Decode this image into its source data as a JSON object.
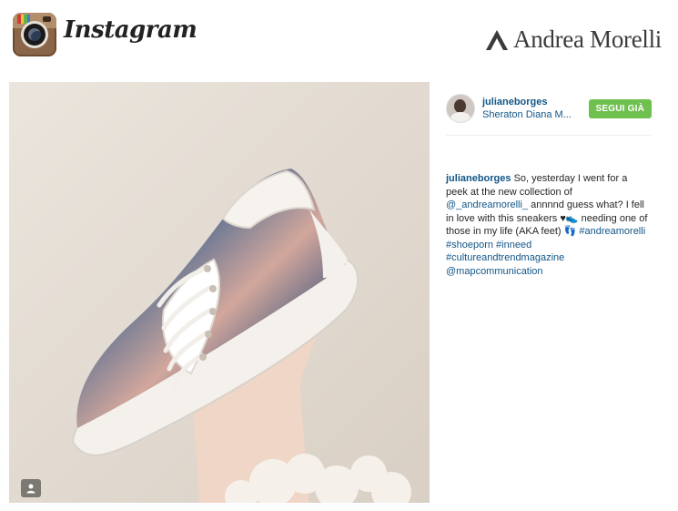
{
  "app": {
    "name": "Instagram"
  },
  "brand": {
    "name": "Andrea Morelli"
  },
  "post": {
    "username": "julianeborges",
    "location": "Sheraton Diana M...",
    "follow_label": "SEGUI GIÀ",
    "caption": {
      "username": "julianeborges",
      "text_1": "So, yesterday I went for a peek at the new collection of",
      "mention_1": "@_andreamorelli_",
      "text_2": "annnnd guess what? I fell in love with this sneakers ♥👟 needing one of those in my life (AKA feet) 👣",
      "hashtags": "#andreamorelli #shoeporn #inneed #cultureandtrendmagazine",
      "mention_2": "@mapcommunication"
    }
  },
  "colors": {
    "link": "#125688",
    "follow_button": "#70c050"
  },
  "icons": {
    "user_tag": "user-tag-icon"
  }
}
